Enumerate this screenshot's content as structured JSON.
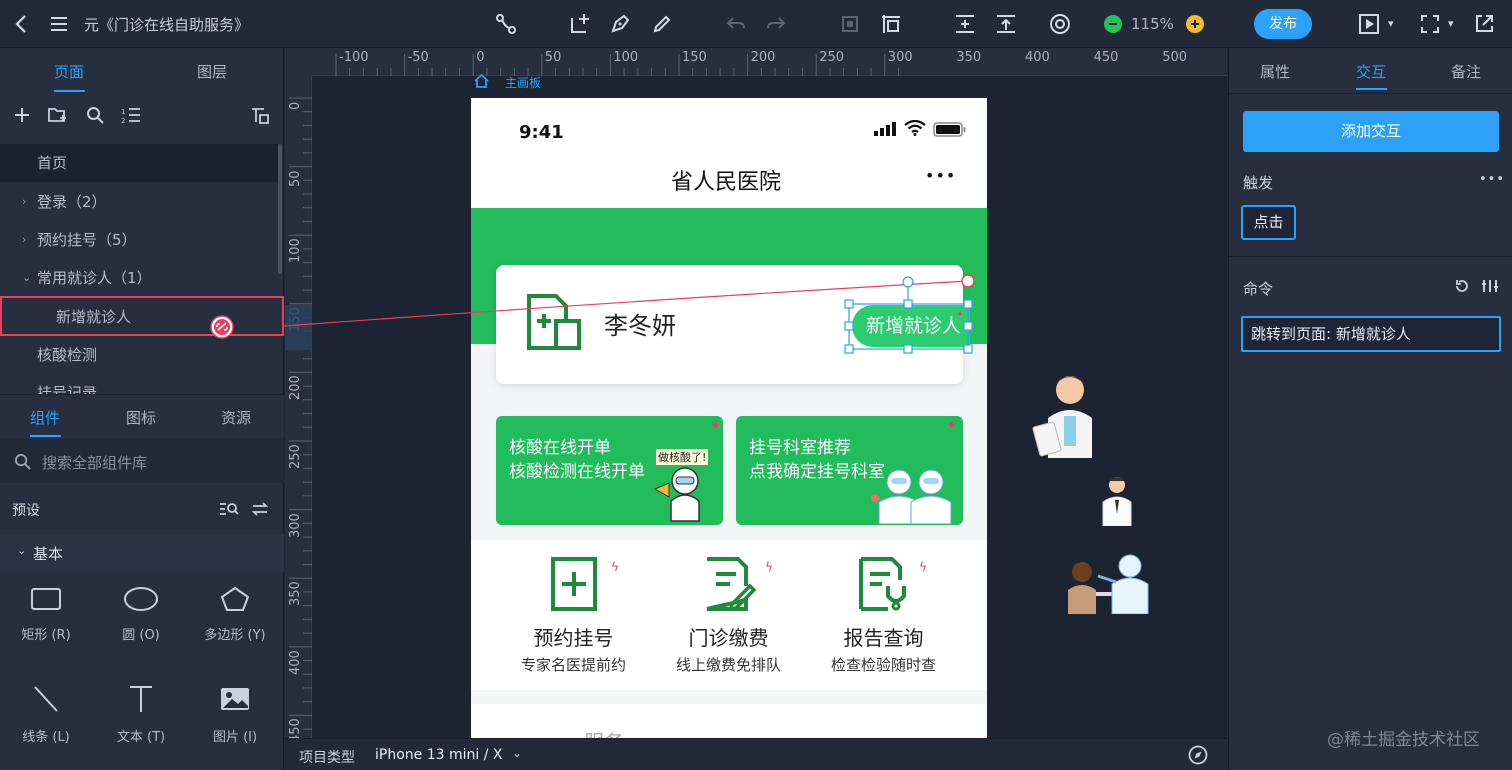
{
  "toolbar": {
    "doc_title": "元《门诊在线自助服务》",
    "zoom_level": "115%",
    "publish_label": "发布"
  },
  "left_panel": {
    "tabs": [
      "页面",
      "图层"
    ],
    "pages": [
      {
        "label": "首页",
        "arrow": ""
      },
      {
        "label": "登录（2）",
        "arrow": "›"
      },
      {
        "label": "预约挂号（5）",
        "arrow": "›"
      },
      {
        "label": "常用就诊人（1）",
        "arrow": "⌄"
      },
      {
        "label": "新增就诊人",
        "arrow": ""
      },
      {
        "label": "核酸检测",
        "arrow": ""
      },
      {
        "label": "挂号记录",
        "arrow": ""
      }
    ],
    "lib_tabs": [
      "组件",
      "图标",
      "资源"
    ],
    "search_placeholder": "搜索全部组件库",
    "preset_label": "预设",
    "basic_label": "基本",
    "components": [
      "矩形 (R)",
      "圆 (O)",
      "多边形 (Y)",
      "线条 (L)",
      "文本 (T)",
      "图片 (I)"
    ]
  },
  "canvas": {
    "ruler_x": [
      "-100",
      "-50",
      "0",
      "50",
      "100",
      "150",
      "200",
      "250",
      "300",
      "350",
      "400",
      "450",
      "500"
    ],
    "ruler_y": [
      "0",
      "50",
      "100",
      "150",
      "200",
      "250",
      "300",
      "350",
      "400",
      "450"
    ],
    "artboard_label": "主画板",
    "project_type_label": "项目类型",
    "project_type_value": "iPhone 13 mini / X"
  },
  "phone": {
    "time": "9:41",
    "title": "省人民医院",
    "more": "•••",
    "patient_name": "李冬妍",
    "add_patient_button": "新增就诊人",
    "card_covid": {
      "line1": "核酸在线开单",
      "line2": "核酸检测在线开单",
      "badge": "做核酸了!"
    },
    "card_dept": {
      "line1": "挂号科室推荐",
      "line2": "点我确定挂号科室"
    },
    "features": [
      {
        "title": "预约挂号",
        "sub": "专家名医提前约"
      },
      {
        "title": "门诊缴费",
        "sub": "线上缴费免排队"
      },
      {
        "title": "报告查询",
        "sub": "检查检验随时查"
      }
    ],
    "section_partial": "服务"
  },
  "right_panel": {
    "tabs": [
      "属性",
      "交互",
      "备注"
    ],
    "add_interaction": "添加交互",
    "trigger_label": "触发",
    "trigger_more": "•••",
    "trigger_value": "点击",
    "command_label": "命令",
    "command_value": "跳转到页面: 新增就诊人"
  },
  "watermark": "@稀土掘金技术社区",
  "colors": {
    "accent": "#2da1f8",
    "brand_green": "#22bc5c",
    "link_red": "#ec3d5c"
  }
}
